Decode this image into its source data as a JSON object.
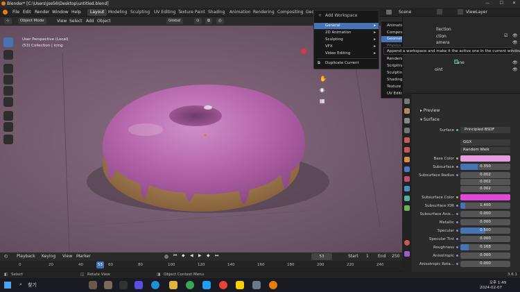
{
  "titlebar": {
    "title": "Blender* [C:\\Users\\jse56\\Desktop\\untitled.blend]"
  },
  "menu": {
    "items": [
      "File",
      "Edit",
      "Render",
      "Window",
      "Help"
    ]
  },
  "workspaces": {
    "tabs": [
      "Layout",
      "Modeling",
      "Sculpting",
      "UV Editing",
      "Texture Paint",
      "Shading",
      "Animation",
      "Rendering",
      "Compositing",
      "Geo"
    ],
    "active": "Layout"
  },
  "header_right": {
    "scene": "Scene",
    "view_layer": "ViewLayer"
  },
  "viewport_header": {
    "mode": "Object Mode",
    "view": "View",
    "select": "Select",
    "add": "Add",
    "object": "Object",
    "transform": "Global"
  },
  "viewport": {
    "perspective": "User Perspective (Local)",
    "collection": "(53) Collection | icing"
  },
  "add_workspace_menu": {
    "title": "Add Workspace",
    "items": [
      "General",
      "2D Animation",
      "Sculpting",
      "VFX",
      "Video Editing"
    ],
    "duplicate": "Duplicate Current"
  },
  "general_submenu": {
    "items": [
      "Animation",
      "Compositing",
      "Geometry Nodes",
      "Physics",
      "Rendering",
      "Scripting",
      "Sculpting",
      "Shading",
      "Texture Paint",
      "UV Editing"
    ],
    "highlighted": "Geometry Nodes"
  },
  "tooltip": "Append a workspace and make it the active one in the current window.",
  "outliner": {
    "items": [
      {
        "label": "llection"
      },
      {
        "label": "ction"
      },
      {
        "label": "amera"
      },
      {
        "label": "lane"
      },
      {
        "label": "oint"
      }
    ]
  },
  "properties": {
    "preview": "Preview",
    "surface_section": "Surface",
    "surface_label": "Surface",
    "surface_value": "Principled BSDF",
    "distribution": "GGX",
    "subsurface_method": "Random Walk",
    "rows": [
      {
        "label": "Base Color",
        "type": "color",
        "color": "#e79cde"
      },
      {
        "label": "Subsurface",
        "type": "num",
        "value": "0.350",
        "fill": 0.35
      },
      {
        "label": "Subsurface Radius",
        "type": "num",
        "value": "0.002",
        "fill": 0
      },
      {
        "label": "",
        "type": "num",
        "value": "0.002",
        "fill": 0
      },
      {
        "label": "",
        "type": "num",
        "value": "0.002",
        "fill": 0
      },
      {
        "label": "Subsurface Color",
        "type": "color",
        "color": "#e048d8"
      },
      {
        "label": "Subsurface IOR",
        "type": "num",
        "value": "1.400",
        "fill": 0.1
      },
      {
        "label": "Subsurface Anis...",
        "type": "num",
        "value": "0.000",
        "fill": 0
      },
      {
        "label": "Metallic",
        "type": "num",
        "value": "0.000",
        "fill": 0
      },
      {
        "label": "Specular",
        "type": "num",
        "value": "0.500",
        "fill": 0.5
      },
      {
        "label": "Specular Tint",
        "type": "num",
        "value": "0.000",
        "fill": 0
      },
      {
        "label": "Roughness",
        "type": "num",
        "value": "0.168",
        "fill": 0.168
      },
      {
        "label": "Anisotropic",
        "type": "num",
        "value": "0.000",
        "fill": 0
      },
      {
        "label": "Anisotropic Rota...",
        "type": "num",
        "value": "0.000",
        "fill": 0
      }
    ]
  },
  "timeline": {
    "playback": "Playback",
    "keying": "Keying",
    "view": "View",
    "marker": "Marker",
    "current_frame": "53",
    "start_label": "Start",
    "start": "1",
    "end_label": "End",
    "end": "250",
    "ticks": [
      "0",
      "20",
      "40",
      "60",
      "80",
      "100",
      "120",
      "140",
      "160",
      "180",
      "200",
      "220",
      "240"
    ]
  },
  "statusbar": {
    "select": "Select",
    "rotate": "Rotate View",
    "context": "Object Context Menu",
    "version": "3.6.1"
  },
  "taskbar": {
    "search": "찾기",
    "time": "오후 1:49",
    "date": "2024-02-07"
  },
  "colors": {
    "accent": "#4772b3",
    "icing": "#b56aa8",
    "dough": "#b78a52"
  }
}
